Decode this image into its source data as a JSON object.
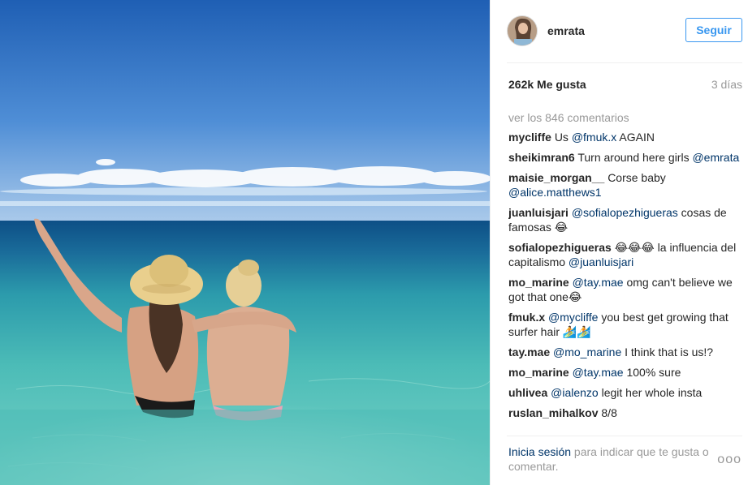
{
  "post": {
    "username": "emrata",
    "follow_label": "Seguir",
    "likes": "262k Me gusta",
    "time_ago": "3 días",
    "view_all_comments": "ver los 846 comentarios",
    "comments": [
      {
        "user": "mycliffe",
        "parts": [
          {
            "text": "Us "
          },
          {
            "mention": "@fmuk.x"
          },
          {
            "text": " AGAIN"
          }
        ]
      },
      {
        "user": "sheikimran6",
        "parts": [
          {
            "text": "Turn around here girls "
          },
          {
            "mention": "@emrata"
          }
        ]
      },
      {
        "user": "maisie_morgan__",
        "parts": [
          {
            "text": "Corse baby "
          },
          {
            "mention": "@alice.matthews1"
          }
        ]
      },
      {
        "user": "juanluisjari",
        "parts": [
          {
            "mention": "@sofialopezhigueras"
          },
          {
            "text": " cosas de famosas 😂"
          }
        ]
      },
      {
        "user": "sofialopezhigueras",
        "parts": [
          {
            "text": "😂😂😂 la influencia del capitalismo "
          },
          {
            "mention": "@juanluisjari"
          }
        ]
      },
      {
        "user": "mo_marine",
        "parts": [
          {
            "mention": "@tay.mae"
          },
          {
            "text": " omg can't believe we got that one😂"
          }
        ]
      },
      {
        "user": "fmuk.x",
        "parts": [
          {
            "mention": "@mycliffe"
          },
          {
            "text": " you best get growing that surfer hair 🏄🏄"
          }
        ]
      },
      {
        "user": "tay.mae",
        "parts": [
          {
            "mention": "@mo_marine"
          },
          {
            "text": " I think that is us!?"
          }
        ]
      },
      {
        "user": "mo_marine",
        "parts": [
          {
            "mention": "@tay.mae"
          },
          {
            "text": " 100% sure"
          }
        ]
      },
      {
        "user": "uhlivea",
        "parts": [
          {
            "mention": "@ialenzo"
          },
          {
            "text": " legit her whole insta"
          }
        ]
      },
      {
        "user": "ruslan_mihalkov",
        "parts": [
          {
            "text": "8/8"
          }
        ]
      }
    ],
    "footer": {
      "login_link": "Inicia sesión",
      "login_text": " para indicar que te gusta o comentar."
    },
    "more_label": "ooo"
  },
  "icons": {
    "more": "more-options-icon"
  },
  "colors": {
    "accent": "#3897f0",
    "mention": "#003569",
    "muted": "#999999"
  }
}
